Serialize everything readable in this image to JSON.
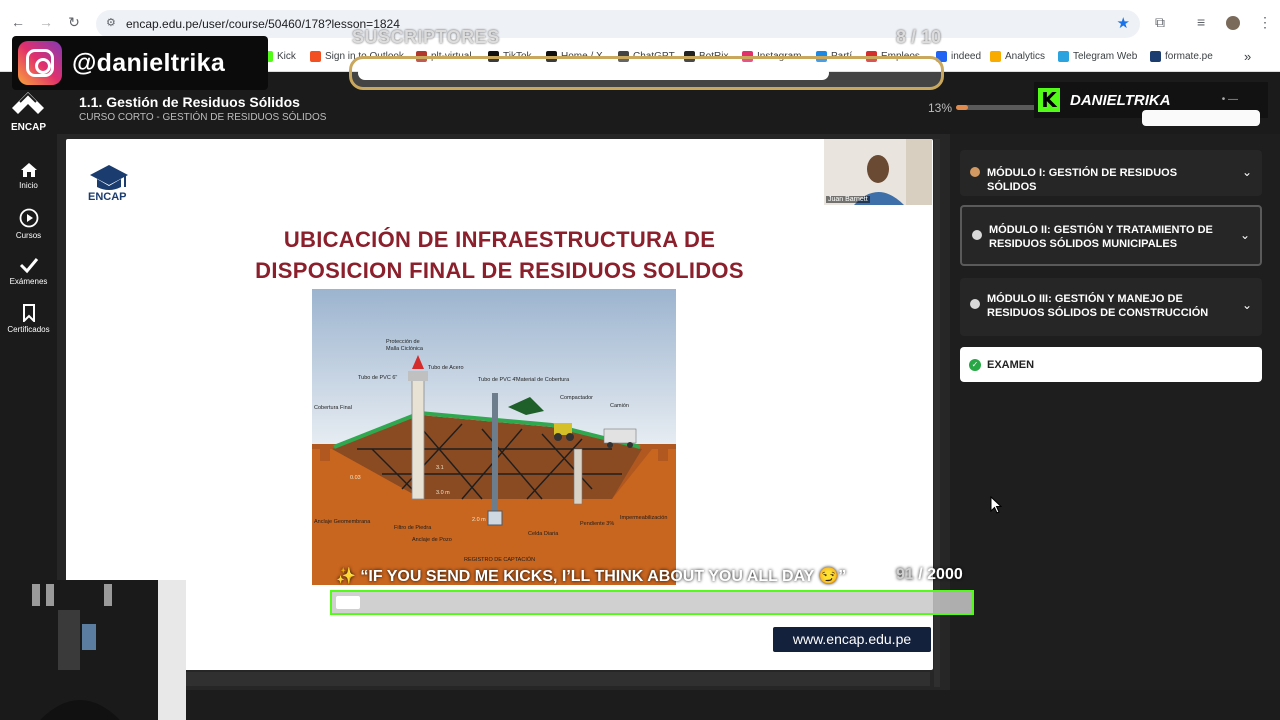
{
  "browser": {
    "url": "encap.edu.pe/user/course/50460/178?lesson=1824",
    "bookmarks": [
      {
        "label": "Kick",
        "color": "#53fc18"
      },
      {
        "label": "Sign in to Outlook",
        "color": "#f25022"
      },
      {
        "label": "plt-virtual",
        "color": "#b0382c"
      },
      {
        "label": "TikTok",
        "color": "#111111"
      },
      {
        "label": "Home / X",
        "color": "#111111"
      },
      {
        "label": "ChatGPT",
        "color": "#444444"
      },
      {
        "label": "BotRix",
        "color": "#222222"
      },
      {
        "label": "Instagram",
        "color": "#e1306c"
      },
      {
        "label": "Partí",
        "color": "#1e88e5"
      },
      {
        "label": "Empleos",
        "color": "#d32f2f"
      },
      {
        "label": "indeed",
        "color": "#2164f3"
      },
      {
        "label": "Analytics",
        "color": "#f9ab00"
      },
      {
        "label": "Telegram Web",
        "color": "#2aa3df"
      },
      {
        "label": "formate.pe",
        "color": "#1a3c6e"
      }
    ]
  },
  "overlays": {
    "instagram_handle": "@danieltrika",
    "subscribers_label": "SUSCRIPTORES",
    "subscribers_count": "8 / 10",
    "subscribers_progress": 0.8,
    "kick_name": "DANIELTRIKA",
    "kick_goal_text": "✨ “IF YOU SEND ME KICKS, I’LL THINK ABOUT YOU ALL DAY 😏”",
    "kick_goal_current": "91",
    "kick_goal_total": "/ 2000"
  },
  "app": {
    "logo_text": "ENCAP",
    "course_title": "1.1. Gestión de Residuos Sólidos",
    "course_subtitle": "CURSO CORTO - GESTIÓN DE RESIDUOS SÓLIDOS",
    "progress_label": "13%",
    "progress_value": 0.13,
    "sidebar": [
      {
        "label": "Inicio",
        "icon": "home-icon"
      },
      {
        "label": "Cursos",
        "icon": "play-icon"
      },
      {
        "label": "Exámenes",
        "icon": "check-icon"
      },
      {
        "label": "Certificados",
        "icon": "bookmark-icon"
      }
    ]
  },
  "slide": {
    "logo_text": "ENCAP",
    "title_line1": "UBICACIÓN DE INFRAESTRUCTURA DE",
    "title_line2": "DISPOSICION FINAL DE RESIDUOS SOLIDOS",
    "presenter": "Juan Barnett",
    "website": "www.encap.edu.pe",
    "diagram_labels": {
      "proteccion": "Protección de Malla Ciclónica",
      "tubo_acero": "Tubo de Acero de 4\"",
      "tubo_pvc": "Tubo de PVC Hidráulico 6\" Ranurado o Trestotillo",
      "tubo_pvc4": "Tubo de PVC 4\"",
      "material": "Material de Cobertura",
      "compactador": "Compactador de Basura",
      "camion": "Camión Recolector",
      "cobertura": "Cobertura Final 0.06 m",
      "anclaje": "Anclaje Geomembrana Tipo",
      "filtro": "Filtro de Piedra Calizo de 4\"- 6\"",
      "pozo": "Anclaje de Pozo de Biogás",
      "registro": "REGISTRO DE CAPTACIÓN DE LIXIVIADOS",
      "celda": "Celda Diaria de Residuos",
      "pendiente": "Pendiente 3%",
      "impermeabilizacion": "Impermeabilización Natural o Artificial",
      "m31": "3.1",
      "m30": "3.0 m",
      "m20": "2.0 m",
      "m003": "0.03"
    }
  },
  "modules": [
    {
      "title": "MÓDULO I: GESTIÓN DE RESIDUOS SÓLIDOS",
      "status": "done"
    },
    {
      "title": "MÓDULO II: GESTIÓN Y TRATAMIENTO DE RESIDUOS SÓLIDOS MUNICIPALES",
      "status": "active"
    },
    {
      "title": "MÓDULO III: GESTIÓN Y MANEJO DE RESIDUOS SÓLIDOS DE CONSTRUCCIÓN",
      "status": "pending"
    }
  ],
  "exam_label": "EXAMEN"
}
